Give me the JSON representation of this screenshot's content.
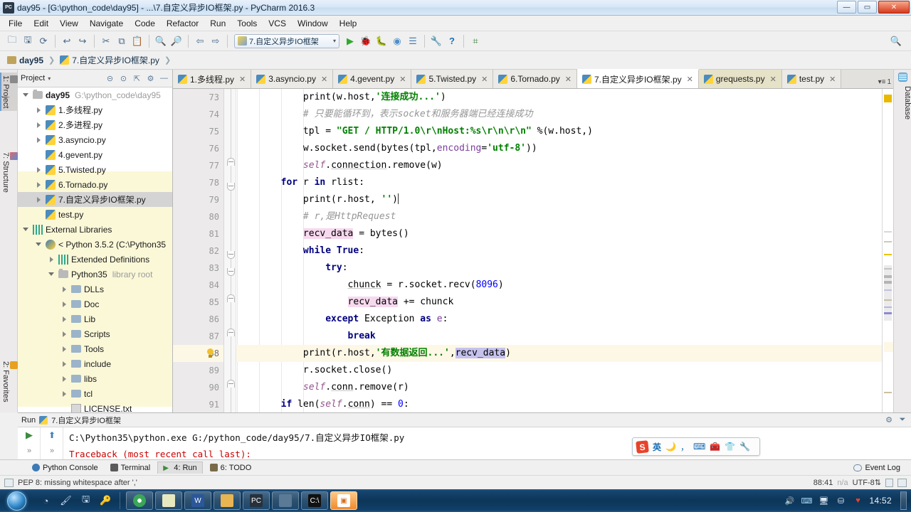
{
  "window": {
    "title": "day95 - [G:\\python_code\\day95] - ...\\7.自定义异步IO框架.py - PyCharm 2016.3",
    "app_icon": "pycharm-icon",
    "minimize": "—",
    "maximize": "▭",
    "close": "✕"
  },
  "menu": {
    "items": [
      "File",
      "Edit",
      "View",
      "Navigate",
      "Code",
      "Refactor",
      "Run",
      "Tools",
      "VCS",
      "Window",
      "Help"
    ]
  },
  "toolbar": {
    "icons": [
      "open-folder-icon",
      "save-all-icon",
      "sync-icon",
      "undo-icon",
      "redo-icon",
      "cut-icon",
      "copy-icon",
      "paste-icon",
      "find-icon",
      "replace-icon",
      "back-icon",
      "forward-icon"
    ],
    "glyphs": [
      "🗀",
      "🖫",
      "⟳",
      "↩",
      "↪",
      "✂",
      "⧉",
      "📋",
      "🔍",
      "🔎",
      "⇦",
      "⇨"
    ],
    "run_config": "7.自定义异步IO框架",
    "run_config_arrow": "▾",
    "right_icons": [
      "run-icon",
      "debug-icon",
      "coverage-icon",
      "profile-icon",
      "attach-icon",
      "settings-icon",
      "help-icon",
      "search-everywhere-icon"
    ],
    "right_glyphs": [
      "▶",
      "🐞",
      "🐛",
      "◉",
      "☰",
      "🔧",
      "?",
      "⌗"
    ],
    "search_icon": "🔍"
  },
  "breadcrumb": {
    "project": "day95",
    "file": "7.自定义异步IO框架.py",
    "separator": "❯"
  },
  "left_tool_tabs": [
    {
      "label": "1: Project",
      "selected": true,
      "icon": "project-icon"
    },
    {
      "label": "7: Structure",
      "selected": false,
      "icon": "structure-icon"
    },
    {
      "label": "2: Favorites",
      "selected": false,
      "icon": "star-icon"
    }
  ],
  "right_tool_tabs": [
    {
      "label": "Database",
      "icon": "database-icon"
    }
  ],
  "project_panel": {
    "title": "Project",
    "chevron": "▾",
    "header_icons": [
      "collapse-all-icon",
      "target-icon",
      "expand-icon",
      "settings-icon",
      "hide-icon"
    ],
    "header_glyphs": [
      "⊝",
      "⊙",
      "⇱",
      "⚙",
      "—"
    ],
    "tree": [
      {
        "indent": 0,
        "twisty": "open",
        "icon": "folder",
        "label": "day95",
        "bold": true,
        "dim": "G:\\python_code\\day95",
        "selected": false
      },
      {
        "indent": 1,
        "twisty": "closed",
        "icon": "py",
        "label": "1.多线程.py",
        "selected": false
      },
      {
        "indent": 1,
        "twisty": "closed",
        "icon": "py",
        "label": "2.多进程.py",
        "selected": false
      },
      {
        "indent": 1,
        "twisty": "closed",
        "icon": "py",
        "label": "3.asyncio.py",
        "selected": false
      },
      {
        "indent": 1,
        "twisty": "none",
        "icon": "py",
        "label": "4.gevent.py",
        "selected": false
      },
      {
        "indent": 1,
        "twisty": "closed",
        "icon": "py",
        "label": "5.Twisted.py",
        "selected": false
      },
      {
        "indent": 1,
        "twisty": "closed",
        "icon": "py",
        "label": "6.Tornado.py",
        "selected": false
      },
      {
        "indent": 1,
        "twisty": "closed",
        "icon": "py",
        "label": "7.自定义异步IO框架.py",
        "selected": true
      },
      {
        "indent": 1,
        "twisty": "none",
        "icon": "py",
        "label": "test.py",
        "selected": false
      },
      {
        "indent": 0,
        "twisty": "open",
        "icon": "lib",
        "label": "External Libraries",
        "selected": false
      },
      {
        "indent": 1,
        "twisty": "open",
        "icon": "sdk",
        "label": "< Python 3.5.2 (C:\\Python35",
        "selected": false
      },
      {
        "indent": 2,
        "twisty": "closed",
        "icon": "lib",
        "label": "Extended Definitions",
        "selected": false
      },
      {
        "indent": 2,
        "twisty": "open",
        "icon": "folder",
        "label": "Python35",
        "dim": "library root",
        "selected": false
      },
      {
        "indent": 3,
        "twisty": "closed",
        "icon": "folderb",
        "label": "DLLs",
        "selected": false
      },
      {
        "indent": 3,
        "twisty": "closed",
        "icon": "folderb",
        "label": "Doc",
        "selected": false
      },
      {
        "indent": 3,
        "twisty": "closed",
        "icon": "folderb",
        "label": "Lib",
        "selected": false
      },
      {
        "indent": 3,
        "twisty": "closed",
        "icon": "folderb",
        "label": "Scripts",
        "selected": false
      },
      {
        "indent": 3,
        "twisty": "closed",
        "icon": "folderb",
        "label": "Tools",
        "selected": false
      },
      {
        "indent": 3,
        "twisty": "closed",
        "icon": "folderb",
        "label": "include",
        "selected": false
      },
      {
        "indent": 3,
        "twisty": "closed",
        "icon": "folderb",
        "label": "libs",
        "selected": false
      },
      {
        "indent": 3,
        "twisty": "closed",
        "icon": "folderb",
        "label": "tcl",
        "selected": false
      },
      {
        "indent": 3,
        "twisty": "none",
        "icon": "txt",
        "label": "LICENSE.txt",
        "selected": false
      }
    ]
  },
  "editor_tabs": {
    "tabs": [
      {
        "label": "1.多线程.py",
        "state": "normal"
      },
      {
        "label": "3.asyncio.py",
        "state": "normal"
      },
      {
        "label": "4.gevent.py",
        "state": "normal"
      },
      {
        "label": "5.Twisted.py",
        "state": "normal"
      },
      {
        "label": "6.Tornado.py",
        "state": "normal"
      },
      {
        "label": "7.自定义异步IO框架.py",
        "state": "active"
      },
      {
        "label": "grequests.py",
        "state": "modified"
      },
      {
        "label": "test.py",
        "state": "normal"
      }
    ],
    "close_glyph": "✕",
    "overflow_label": "1",
    "overflow_glyph": "▾≡"
  },
  "code": {
    "first_line": 73,
    "current_line": 88,
    "lines": [
      {
        "n": 73,
        "html": "            print(w.host,<span class=\"str\">'连接成功...'</span>)"
      },
      {
        "n": 74,
        "html": "            <span class=\"cmt\"># 只要能循环到，表示socket和服务器端已经连接成功</span>"
      },
      {
        "n": 75,
        "html": "            tpl = <span class=\"str\">\"GET / HTTP/1.0\\r\\nHost:%s\\r\\n\\r\\n\"</span> %(w.host,)"
      },
      {
        "n": 76,
        "html": "            w.socket.send(bytes(tpl,<span class=\"param\">encoding</span>=<span class=\"str\">'utf-8'</span>))"
      },
      {
        "n": 77,
        "html": "            <span class=\"selfk\">self</span>.<span class=\"fld\">connection</span>.remove(w)"
      },
      {
        "n": 78,
        "html": "        <span class=\"kw\">for</span> r <span class=\"kw\">in</span> rlist:"
      },
      {
        "n": 79,
        "html": "            print(r.host, <span class=\"str\">''</span>)<span class=\"caret\"></span>"
      },
      {
        "n": 80,
        "html": "            <span class=\"cmt\"># r,是HttpRequest</span>"
      },
      {
        "n": 81,
        "html": "            <span class=\"hl-pink\">recv_data</span> = bytes()"
      },
      {
        "n": 82,
        "html": "            <span class=\"kw\">while True</span>:"
      },
      {
        "n": 83,
        "html": "                <span class=\"kw\">try</span>:"
      },
      {
        "n": 84,
        "html": "                    <span class=\"fld\">chunck</span> = r.socket.recv(<span class=\"num\">8096</span>)"
      },
      {
        "n": 85,
        "html": "                    <span class=\"hl-pink\">recv_data</span> += chunck"
      },
      {
        "n": 86,
        "html": "                <span class=\"kw\">except</span> Exception <span class=\"kw\">as</span> <span class=\"param\">e</span>:"
      },
      {
        "n": 87,
        "html": "                    <span class=\"kw\">break</span>"
      },
      {
        "n": 88,
        "html": "            print(r.host,<span class=\"str\">'有数据返回...'</span>,<span class=\"hl-lav\">recv_data</span>)"
      },
      {
        "n": 89,
        "html": "            r.socket.close()"
      },
      {
        "n": 90,
        "html": "            <span class=\"selfk\">self</span>.<span class=\"fld\">conn</span>.remove(r)"
      },
      {
        "n": 91,
        "html": "        <span class=\"kw\">if</span> len(<span class=\"selfk\">self</span>.<span class=\"fld\">conn</span>) == <span class=\"num\">0</span>:"
      }
    ],
    "plain_lines": [
      "            print(w.host,'连接成功...')",
      "            # 只要能循环到，表示socket和服务器端已经连接成功",
      "            tpl = \"GET / HTTP/1.0\\r\\nHost:%s\\r\\n\\r\\n\" %(w.host,)",
      "            w.socket.send(bytes(tpl,encoding='utf-8'))",
      "            self.connection.remove(w)",
      "        for r in rlist:",
      "            print(r.host, '')",
      "            # r,是HttpRequest",
      "            recv_data = bytes()",
      "            while True:",
      "                try:",
      "                    chunck = r.socket.recv(8096)",
      "                    recv_data += chunck",
      "                except Exception as e:",
      "                    break",
      "            print(r.host,'有数据返回...',recv_data)",
      "            r.socket.close()",
      "            self.conn.remove(r)",
      "        if len(self.conn) == 0:"
    ],
    "fold_markers": [
      {
        "line": 77,
        "type": "up"
      },
      {
        "line": 78,
        "type": "dn"
      },
      {
        "line": 82,
        "type": "dn"
      },
      {
        "line": 83,
        "type": "dn"
      },
      {
        "line": 85,
        "type": "up"
      },
      {
        "line": 87,
        "type": "up"
      },
      {
        "line": 90,
        "type": "up"
      }
    ],
    "intention_bulb_line": 88,
    "intention_bulb_icon": "lightbulb-icon"
  },
  "run_panel": {
    "title": "Run",
    "config_name": "7.自定义异步IO框架",
    "header_icons": [
      "settings-icon",
      "hide-icon"
    ],
    "header_glyphs": [
      "⚙",
      "⏷"
    ],
    "side_icons": [
      "rerun-icon",
      "scroll-up-icon",
      "expand-down-icon",
      "expand-down-2-icon"
    ],
    "side_glyphs": [
      "▶",
      "⬆",
      "»",
      "»"
    ],
    "console_lines": [
      {
        "text": "C:\\Python35\\python.exe G:/python_code/day95/7.自定义异步IO框架.py",
        "kind": "ok"
      },
      {
        "text": "Traceback (most recent call last):",
        "kind": "err"
      }
    ]
  },
  "ime": {
    "logo": "S",
    "mode": "英",
    "icons": [
      "moon-icon",
      "comma-icon",
      "keyboard-icon",
      "toolbox-icon",
      "skin-icon",
      "wrench-icon"
    ],
    "glyphs": [
      "🌙",
      "，",
      "⌨",
      "🧰",
      "👕",
      "🔧"
    ]
  },
  "toolwindow_bar": {
    "items": [
      {
        "label": "Python Console",
        "icon": "python-console-icon",
        "selected": false
      },
      {
        "label": "Terminal",
        "icon": "terminal-icon",
        "selected": false
      },
      {
        "label": "4: Run",
        "icon": "run-icon",
        "selected": true
      },
      {
        "label": "6: TODO",
        "icon": "todo-icon",
        "selected": false
      }
    ],
    "event_log": "Event Log",
    "event_log_icon": "message-bubble-icon"
  },
  "status_bar": {
    "message": "PEP 8: missing whitespace after ','",
    "message_icon": "inspection-icon",
    "caret_position": "88:41",
    "line_separator": "n/a",
    "encoding": "UTF-8",
    "encoding_arrow": "⇅",
    "lock_icon": "lock-icon",
    "inspection_icon": "hector-icon"
  },
  "taskbar": {
    "start_icon": "windows-start-orb",
    "quick_launch": [
      {
        "icon": "media-player-icon",
        "glyph": "◔"
      },
      {
        "icon": "paint-icon",
        "glyph": "🖌"
      },
      {
        "icon": "save-icon",
        "glyph": "🖫"
      },
      {
        "icon": "key-icon",
        "glyph": "🔑"
      }
    ],
    "tasks": [
      {
        "icon": "chrome-icon",
        "label": "",
        "active": false,
        "color": "#3aa757"
      },
      {
        "icon": "notepad-icon",
        "label": "",
        "active": false,
        "color": "#e8e8c0"
      },
      {
        "icon": "word-icon",
        "label": "W",
        "active": false,
        "color": "#2b579a"
      },
      {
        "icon": "explorer-icon",
        "label": "",
        "active": false,
        "color": "#e8b552"
      },
      {
        "icon": "pycharm-icon",
        "label": "PC",
        "active": false,
        "color": "#27313c"
      },
      {
        "icon": "media-icon",
        "label": "",
        "active": false,
        "color": "#5a7a96"
      },
      {
        "icon": "cmd-icon",
        "label": "C:\\",
        "active": false,
        "color": "#111111"
      },
      {
        "icon": "active-app-icon",
        "label": "",
        "active": true,
        "color": "#d96d1f"
      }
    ],
    "tray": [
      {
        "icon": "heart-icon",
        "glyph": "♥",
        "color": "#e8432a"
      },
      {
        "icon": "network-share-icon",
        "glyph": "⛁",
        "color": "#dce9f5"
      },
      {
        "icon": "monitor-icon",
        "glyph": "🖥",
        "color": "#dce9f5"
      },
      {
        "icon": "ime-tray-icon",
        "glyph": "⌨",
        "color": "#9fd2f2"
      },
      {
        "icon": "volume-icon",
        "glyph": "🔊",
        "color": "#dce9f5"
      }
    ],
    "clock": "14:52"
  },
  "colors": {
    "accent": "#6f9fcf",
    "keyword": "#000080",
    "string": "#008000",
    "comment": "#969696",
    "number": "#0000ff",
    "self": "#94558d",
    "error": "#cc0000",
    "current_line": "#fdf8e6",
    "highlight_pink": "#f7d9ef",
    "highlight_lavender": "#c5c2ee",
    "tree_yellow": "#fbf8d8"
  }
}
